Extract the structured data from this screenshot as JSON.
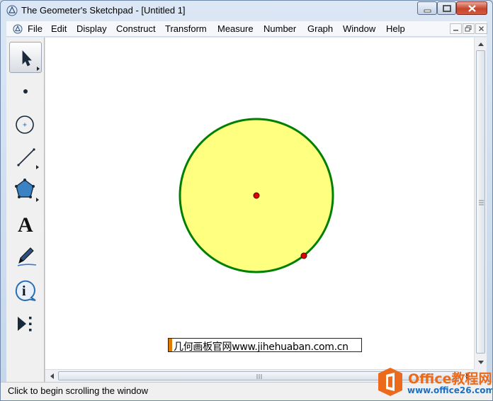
{
  "window": {
    "title": "The Geometer's Sketchpad - [Untitled 1]"
  },
  "menu": {
    "items": [
      "File",
      "Edit",
      "Display",
      "Construct",
      "Transform",
      "Measure",
      "Number",
      "Graph",
      "Window",
      "Help"
    ]
  },
  "toolbox": {
    "tools": [
      {
        "name": "selection-arrow-tool",
        "icon": "arrow-cursor-icon"
      },
      {
        "name": "point-tool",
        "icon": "point-icon"
      },
      {
        "name": "compass-tool",
        "icon": "circle-icon"
      },
      {
        "name": "straightedge-tool",
        "icon": "segment-icon"
      },
      {
        "name": "polygon-tool",
        "icon": "pentagon-icon"
      },
      {
        "name": "text-tool",
        "icon": "text-a-icon",
        "glyph": "A"
      },
      {
        "name": "marker-tool",
        "icon": "marker-pen-icon"
      },
      {
        "name": "information-tool",
        "icon": "info-icon",
        "glyph": "i"
      },
      {
        "name": "custom-tool",
        "icon": "custom-tool-icon"
      }
    ]
  },
  "sketch": {
    "circle_fill": "#ffff80",
    "circle_stroke": "#008000",
    "point_color": "#dd0000"
  },
  "statusbar": {
    "text": "Click to begin scrolling the window"
  },
  "watermark": {
    "text": "几何画板官网www.jihehuaban.com.cn"
  },
  "office_badge": {
    "title": "Office教程网",
    "url": "www.office26.com"
  },
  "colors": {
    "accent_orange": "#ec6a1c",
    "link_blue": "#1e6fc1"
  }
}
